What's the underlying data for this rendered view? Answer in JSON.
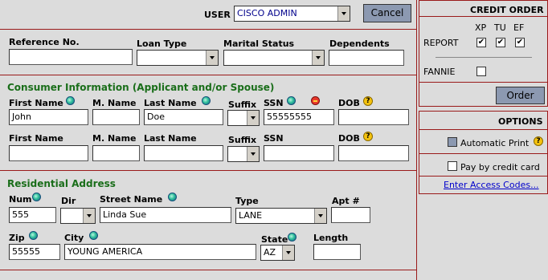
{
  "topbar": {
    "user_label": "USER",
    "user_value": "CISCO ADMIN",
    "cancel_label": "Cancel"
  },
  "loan": {
    "reference_label": "Reference No.",
    "reference_value": "",
    "loan_type_label": "Loan Type",
    "loan_type_value": "",
    "marital_label": "Marital Status",
    "marital_value": "",
    "dependents_label": "Dependents",
    "dependents_value": ""
  },
  "consumer": {
    "section_title": "Consumer Information (Applicant and/or Spouse)",
    "first_name_label": "First Name",
    "middle_name_label": "M. Name",
    "last_name_label": "Last Name",
    "suffix_label": "Suffix",
    "ssn_label": "SSN",
    "dob_label": "DOB",
    "applicant": {
      "first": "John",
      "middle": "",
      "last": "Doe",
      "suffix": "",
      "ssn": "55555555",
      "dob": ""
    },
    "spouse": {
      "first": "",
      "middle": "",
      "last": "",
      "suffix": "",
      "ssn": "",
      "dob": ""
    }
  },
  "address": {
    "section_title": "Residential Address",
    "num_label": "Num",
    "dir_label": "Dir",
    "street_label": "Street Name",
    "type_label": "Type",
    "apt_label": "Apt #",
    "zip_label": "Zip",
    "city_label": "City",
    "state_label": "State",
    "length_label": "Length",
    "num_value": "555",
    "dir_value": "",
    "street_value": "Linda Sue",
    "type_value": "LANE",
    "apt_value": "",
    "zip_value": "55555",
    "city_value": "YOUNG AMERICA",
    "state_value": "AZ",
    "length_value": ""
  },
  "credit_order": {
    "title": "CREDIT ORDER",
    "col_xp": "XP",
    "col_tu": "TU",
    "col_ef": "EF",
    "report_label": "REPORT",
    "report_checks": [
      "✔",
      "✔",
      "✔"
    ],
    "fannie_label": "FANNIE",
    "order_label": "Order"
  },
  "options": {
    "title": "OPTIONS",
    "automatic_print": "Automatic Print",
    "pay_by_credit": "Pay by credit card",
    "access_codes_link": "Enter Access Codes..."
  }
}
